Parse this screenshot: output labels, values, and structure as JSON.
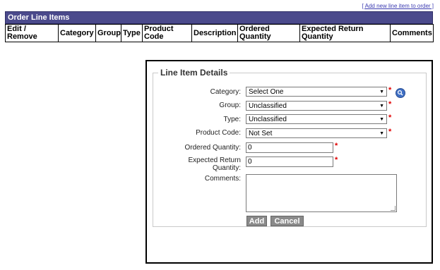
{
  "add_link": "[ Add new line item to order ]",
  "table": {
    "title": "Order Line Items",
    "columns": [
      "Edit / Remove",
      "Category",
      "Group",
      "Type",
      "Product Code",
      "Description",
      "Ordered Quantity",
      "Expected Return Quantity",
      "Comments"
    ]
  },
  "details": {
    "legend": "Line Item Details",
    "category": {
      "label": "Category:",
      "value": "Select One"
    },
    "group": {
      "label": "Group:",
      "value": "Unclassified"
    },
    "type": {
      "label": "Type:",
      "value": "Unclassified"
    },
    "product_code": {
      "label": "Product Code:",
      "value": "Not Set"
    },
    "ordered_qty": {
      "label": "Ordered Quantity:",
      "value": "0"
    },
    "expected_return": {
      "label_1": "Expected Return",
      "label_2": "Quantity:",
      "value": "0"
    },
    "comments": {
      "label": "Comments:",
      "value": ""
    },
    "required_marker": "*",
    "dropdown_arrow": "▼",
    "add_button": "Add",
    "cancel_button": "Cancel"
  },
  "colors": {
    "header_bg": "#4b4a8c",
    "required": "#e00000",
    "button_bg": "#8a8a8a",
    "search_icon": "#3f6fc4"
  },
  "icons": [
    "search-icon",
    "chevron-down-icon",
    "resize-grip-icon"
  ]
}
